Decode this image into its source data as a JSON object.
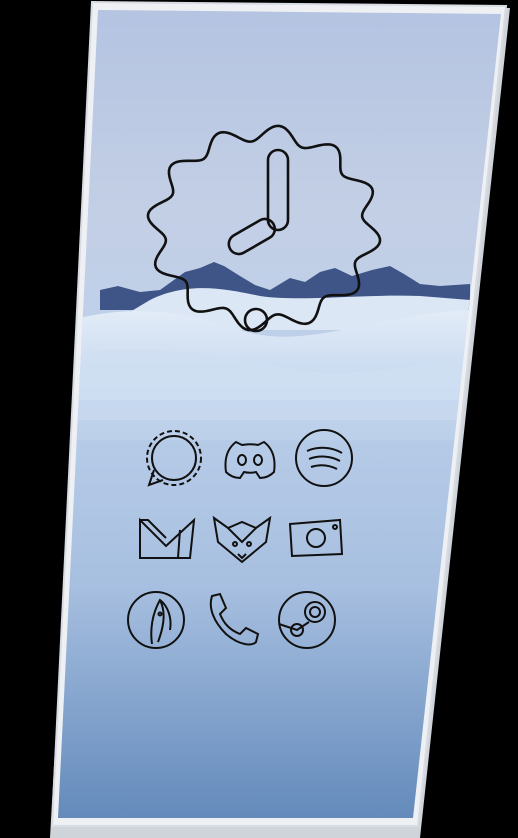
{
  "screen": {
    "background": "#000000",
    "frame_color": "#e9ecf2",
    "sky_top": "#b7c6e2",
    "sky_bottom": "#5f86b8",
    "snow": "#dfe9f6",
    "mountain": "#3a4d7a",
    "icon_stroke": "#111111"
  },
  "clock_widget": {
    "icon": "clock-widget-icon",
    "shape": "wavy-circle",
    "time_shown": "8:00",
    "interactable": true
  },
  "app_icons": [
    {
      "name": "signal",
      "icon": "signal-icon"
    },
    {
      "name": "discord",
      "icon": "discord-icon"
    },
    {
      "name": "spotify",
      "icon": "spotify-icon"
    },
    {
      "name": "gmail",
      "icon": "gmail-icon"
    },
    {
      "name": "firefox",
      "icon": "firefox-icon"
    },
    {
      "name": "camera",
      "icon": "camera-icon"
    },
    {
      "name": "browser",
      "icon": "browser-icon"
    },
    {
      "name": "phone",
      "icon": "phone-icon"
    },
    {
      "name": "steam",
      "icon": "steam-icon"
    }
  ]
}
